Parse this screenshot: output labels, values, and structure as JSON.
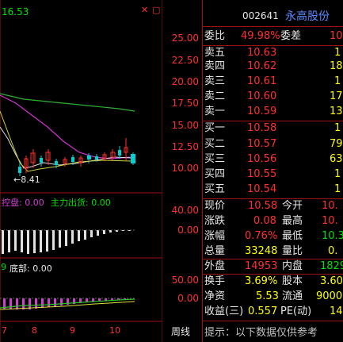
{
  "chart_header": {
    "ma_value": "16.53",
    "close_btn": "✕",
    "menu_btn": "▢"
  },
  "stock": {
    "code": "002641",
    "name": "永高股份"
  },
  "price_axis": [
    "25.00",
    "22.50",
    "20.00",
    "17.50",
    "15.00",
    "12.50",
    "10.00"
  ],
  "low_marker": "8.41",
  "mid_panel": {
    "label1": "控盘: 0.00",
    "label2": "主力出货: 0.00",
    "axis": [
      "40.00",
      "0.00"
    ]
  },
  "low_panel": {
    "label1": "9",
    "label2": "底部: 0.00",
    "axis": [
      "50.00",
      "0.00"
    ]
  },
  "date_axis": [
    "7",
    "8",
    "9",
    "10"
  ],
  "cycle_label": "周线",
  "quote": {
    "weibi_label": "委比",
    "weibi_value": "49.98%",
    "weicha_label": "委差",
    "weicha_value": "10",
    "sell": [
      {
        "label": "卖五",
        "price": "10.63",
        "vol": "1"
      },
      {
        "label": "卖四",
        "price": "10.62",
        "vol": "18"
      },
      {
        "label": "卖三",
        "price": "10.61",
        "vol": "1"
      },
      {
        "label": "卖二",
        "price": "10.60",
        "vol": "17"
      },
      {
        "label": "卖一",
        "price": "10.59",
        "vol": "13"
      }
    ],
    "buy": [
      {
        "label": "买一",
        "price": "10.58",
        "vol": "1"
      },
      {
        "label": "买二",
        "price": "10.57",
        "vol": "79"
      },
      {
        "label": "买三",
        "price": "10.56",
        "vol": "63"
      },
      {
        "label": "买四",
        "price": "10.55",
        "vol": "1"
      },
      {
        "label": "买五",
        "price": "10.54",
        "vol": "1"
      }
    ],
    "stats": [
      {
        "l1": "现价",
        "v1": "10.58",
        "l2": "今开",
        "v2": "10."
      },
      {
        "l1": "涨跌",
        "v1": "0.08",
        "l2": "最高",
        "v2": "10."
      },
      {
        "l1": "涨幅",
        "v1": "0.76%",
        "l2": "最低",
        "v2": "10.3"
      },
      {
        "l1": "总量",
        "v1": "33248",
        "l2": "量比",
        "v2": "0."
      },
      {
        "l1": "外盘",
        "v1": "14953",
        "l2": "内盘",
        "v2": "1829"
      },
      {
        "l1": "换手",
        "v1": "3.69%",
        "l2": "股本",
        "v2": "3.60"
      },
      {
        "l1": "净资",
        "v1": "5.53",
        "l2": "流通",
        "v2": "9000"
      },
      {
        "l1": "收益(三)",
        "v1": "0.557",
        "l2": "PE(动)",
        "v2": "14"
      }
    ],
    "notice": "提示：以下数据仅供参考"
  },
  "colors": {
    "up": "#ff3030",
    "down": "#00e000",
    "border": "#a01010",
    "ma_magenta": "#e040e0",
    "ma_green": "#40c040",
    "ma_white": "#e0e0e0",
    "ma_yellow": "#e0e040"
  }
}
